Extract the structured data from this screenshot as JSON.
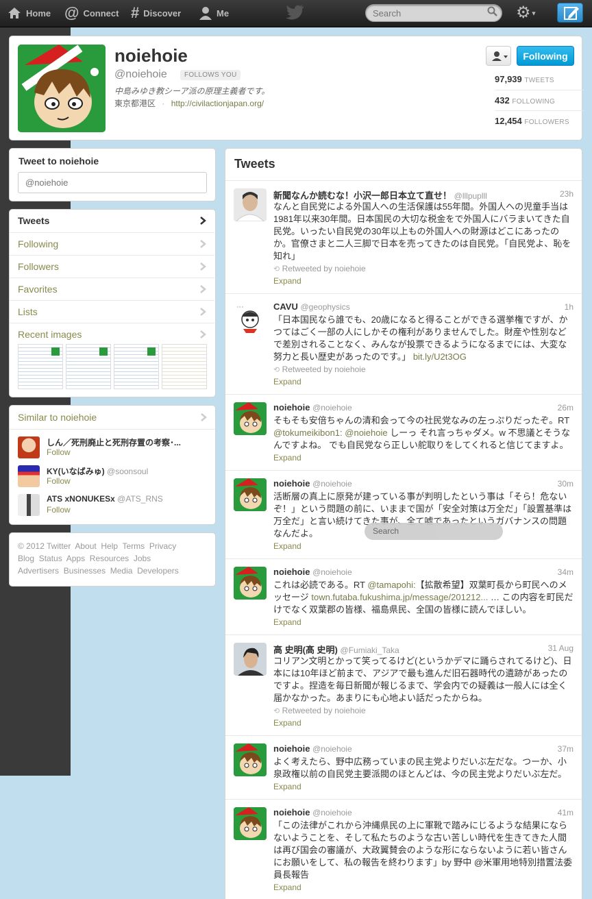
{
  "topbar": {
    "home": "Home",
    "connect": "Connect",
    "discover": "Discover",
    "me": "Me",
    "search_placeholder": "Search"
  },
  "profile": {
    "name": "noiehoie",
    "handle": "@noiehoie",
    "follows_you": "FOLLOWS YOU",
    "bio": "中島みゆき教シーア派の原理主義者です。",
    "location": "東京都港区",
    "sep": "·",
    "url": "http://civilactionjapan.org/",
    "following_button": "Following",
    "stats": [
      {
        "value": "97,939",
        "label": "TWEETS"
      },
      {
        "value": "432",
        "label": "FOLLOWING"
      },
      {
        "value": "12,454",
        "label": "FOLLOWERS"
      }
    ]
  },
  "tweet_to": {
    "title": "Tweet to noiehoie",
    "placeholder": "@noiehoie"
  },
  "side_nav": [
    {
      "label": "Tweets"
    },
    {
      "label": "Following"
    },
    {
      "label": "Followers"
    },
    {
      "label": "Favorites"
    },
    {
      "label": "Lists"
    },
    {
      "label": "Recent images"
    }
  ],
  "similar": {
    "title": "Similar to noiehoie",
    "users": [
      {
        "name": "しん／死刑廃止と死刑存置の考察･...",
        "handle": "",
        "follow": "Follow"
      },
      {
        "name": "KY(いなばみゅ)",
        "handle": "@soonsoul",
        "follow": "Follow"
      },
      {
        "name": "ATS xNONUKESx",
        "handle": "@ATS_RNS",
        "follow": "Follow"
      }
    ]
  },
  "footer": {
    "row1": [
      "© 2012 Twitter",
      "About",
      "Help",
      "Terms",
      "Privacy"
    ],
    "row2": [
      "Blog",
      "Status",
      "Apps",
      "Resources",
      "Jobs"
    ],
    "row3": [
      "Advertisers",
      "Businesses",
      "Media",
      "Developers"
    ]
  },
  "tweets_title": "Tweets",
  "float_search": "Search",
  "tweets": [
    {
      "name": "新聞なんか読むな！小沢一郎日本立て直せ！",
      "handle": "@lllpuplll",
      "time": "23h",
      "text": "なんと自民党による外国人への生活保護は55年間。外国人への児童手当は1981年以来30年間。日本国民の大切な税金をで外国人にバラまいてきた自民党。いったい自民党の30年以上もの外国人への財源はどこにあったのか。官僚さまと二人三脚で日本を売ってきたのは自民党。「自民党よ、恥を知れ」",
      "retweeted": "Retweeted by noiehoie",
      "expand": "Expand"
    },
    {
      "name": "CAVU",
      "handle": "@geophysics",
      "time": "1h",
      "text": "「日本国民なら誰でも、20歳になると得ることができる選挙権ですが、かつてはごく一部の人にしかその権利がありませんでした。財産や性別などで差別されることなく、みんなが投票できるようになるまでには、大変な努力と長い歴史があったのです。」",
      "link": "bit.ly/U2t3OG",
      "retweeted": "Retweeted by noiehoie",
      "expand": "Expand"
    },
    {
      "name": "noiehoie",
      "handle": "@noiehoie",
      "time": "26m",
      "text_a": "そもそも安倍ちゃんの清和会って今の社民党なみの左っぷりだったぞ。RT ",
      "mention1": "@tokumeikibon1:",
      "mention2": "@noiehoie",
      "text_b": " しーっ それ言っちゃダメ。w 不思議とそうなんですよね。 でも自民党なら正しい舵取りをしてくれると信じてますよ。",
      "expand": "Expand"
    },
    {
      "name": "noiehoie",
      "handle": "@noiehoie",
      "time": "30m",
      "text": "活断層の真上に原発が建っている事が判明したという事は「そら！危ないぞ！」という問題の前に、いままで国が「安全対策は万全だ」「設置基準は万全だ」と言い続けてきた事が、全て嘘であったというガバナンスの問題なんだよ。",
      "expand": "Expand"
    },
    {
      "name": "noiehoie",
      "handle": "@noiehoie",
      "time": "34m",
      "text_a": "これは必読である。RT ",
      "mention1": "@tamapohi:",
      "text_b": "【拡散希望】双葉町長から町民へのメッセージ ",
      "link": "town.futaba.fukushima.jp/message/201212...",
      "text_c": " … この内容を町民だけでなく双葉郡の皆様、福島県民、全国の皆様に読んでほしい。",
      "expand": "Expand"
    },
    {
      "name": "高 史明(髙 史明)",
      "handle": "@Fumiaki_Taka",
      "time": "31 Aug",
      "text": "コリアン文明とかって笑ってるけど(というかデマに踊らされてるけど)、日本には10年ほど前まで、アジアで最も進んだ旧石器時代の遺跡があったのですよ。捏造を毎日新聞が報じるまで、学会内での疑義は一般人には全く届かなかった。あまりにも心地よい話だったからね。",
      "retweeted": "Retweeted by noiehoie",
      "expand": "Expand"
    },
    {
      "name": "noiehoie",
      "handle": "@noiehoie",
      "time": "37m",
      "text": "よく考えたら、野中広務っていまの民主党よりだいぶ左だな。つーか、小泉政権以前の自民党主要派閥のほとんどは、今の民主党よりだいぶ左だ。",
      "expand": "Expand"
    },
    {
      "name": "noiehoie",
      "handle": "@noiehoie",
      "time": "41m",
      "text": "「この法律がこれから沖縄県民の上に軍靴で踏みにじるような結果にならないようことを、そして私たちのような古い苦しい時代を生きてきた人間は再び国会の審議が、大政翼賛会のような形にならないように若い皆さんにお願いをして、私の報告を終わります」by 野中 @米軍用地特別措置法委員長報告",
      "expand": "Expand"
    }
  ]
}
